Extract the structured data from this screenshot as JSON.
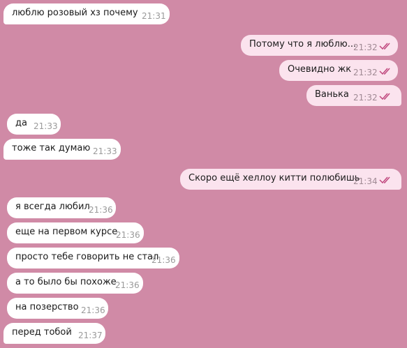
{
  "colors": {
    "background": "#d08aa6",
    "incoming_bubble": "#ffffff",
    "outgoing_bubble": "#fbe3ee",
    "read_check": "#c0487e"
  },
  "messages": [
    {
      "text": "люблю розовый хз почему",
      "time": "21:31",
      "dir": "in"
    },
    {
      "text": "Потому что я люблю...",
      "time": "21:32",
      "dir": "out",
      "status": "read"
    },
    {
      "text": "Очевидно жк",
      "time": "21:32",
      "dir": "out",
      "status": "read"
    },
    {
      "text": "Ванька",
      "time": "21:32",
      "dir": "out",
      "status": "read"
    },
    {
      "text": "да",
      "time": "21:33",
      "dir": "in"
    },
    {
      "text": "тоже так думаю",
      "time": "21:33",
      "dir": "in"
    },
    {
      "text": "Скоро ещё хеллоу китти полюбишь",
      "time": "21:34",
      "dir": "out",
      "status": "read"
    },
    {
      "text": "я всегда любил",
      "time": "21:36",
      "dir": "in"
    },
    {
      "text": "еще на первом курсе",
      "time": "21:36",
      "dir": "in"
    },
    {
      "text": "просто тебе говорить не стал",
      "time": "21:36",
      "dir": "in"
    },
    {
      "text": "а то было бы похоже",
      "time": "21:36",
      "dir": "in"
    },
    {
      "text": "на позерство",
      "time": "21:36",
      "dir": "in"
    },
    {
      "text": "перед тобой",
      "time": "21:37",
      "dir": "in"
    }
  ]
}
